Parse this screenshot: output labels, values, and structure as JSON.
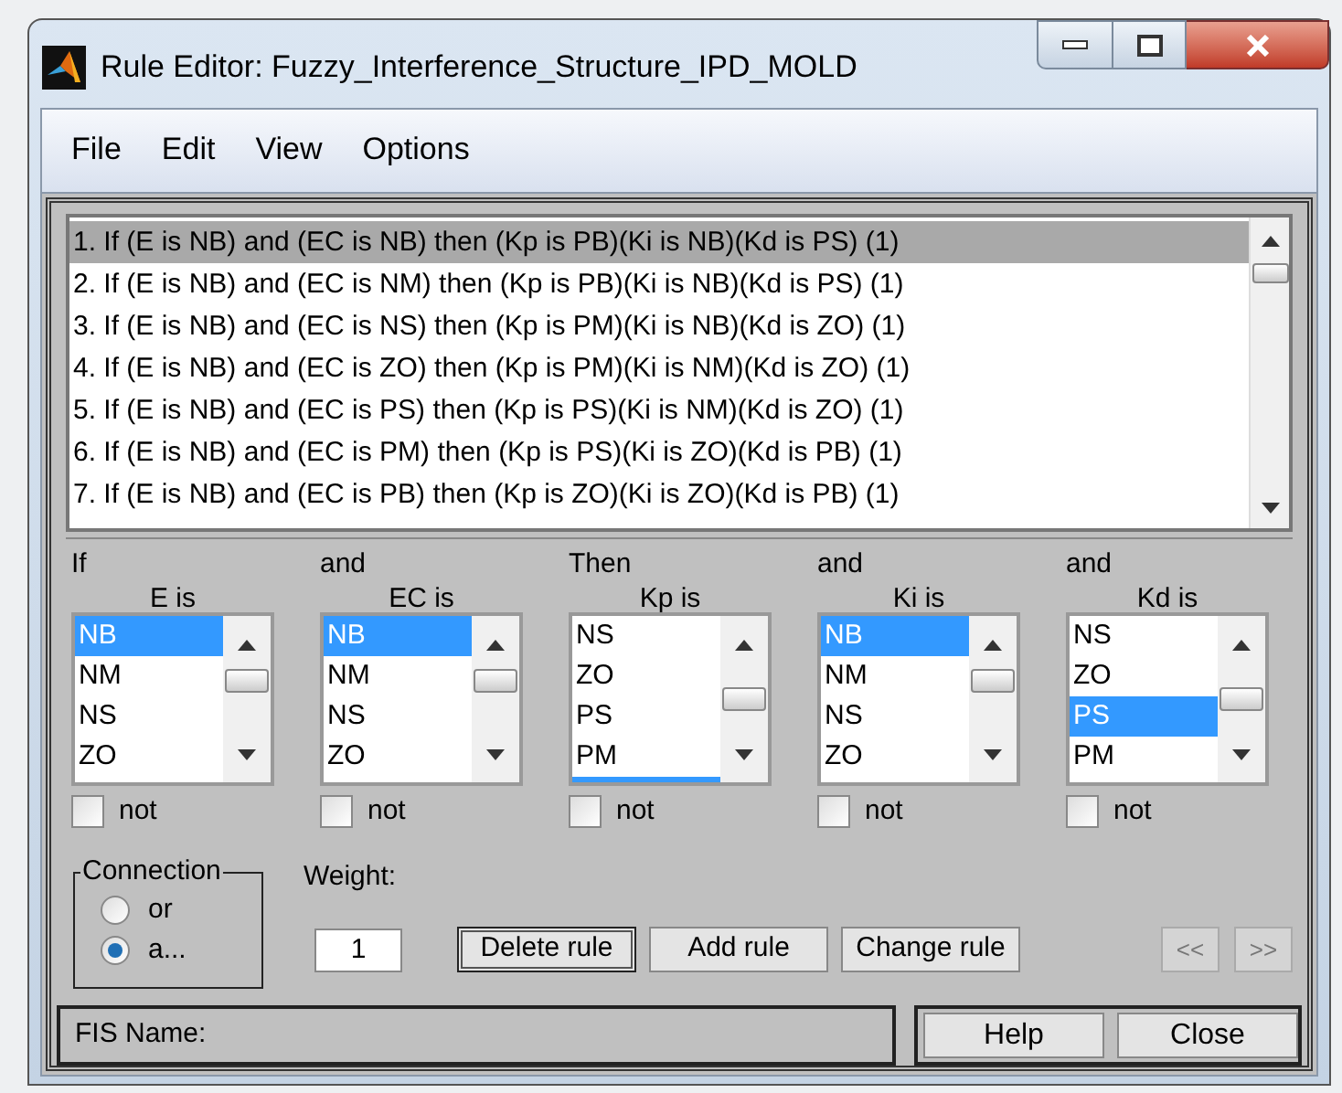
{
  "window": {
    "title": "Rule Editor: Fuzzy_Interference_Structure_IPD_MOLD"
  },
  "menu": [
    "File",
    "Edit",
    "View",
    "Options"
  ],
  "rules": [
    {
      "text": "1. If (E is NB) and (EC is NB) then (Kp is PB)(Ki is NB)(Kd is PS) (1)",
      "selected": true
    },
    {
      "text": "2. If (E is NB) and (EC is NM) then (Kp is PB)(Ki is NB)(Kd is PS) (1)",
      "selected": false
    },
    {
      "text": "3. If (E is NB) and (EC is NS) then (Kp is PM)(Ki is NB)(Kd is ZO) (1)",
      "selected": false
    },
    {
      "text": "4. If (E is NB) and (EC is ZO) then (Kp is PM)(Ki is NM)(Kd is ZO) (1)",
      "selected": false
    },
    {
      "text": "5. If (E is NB) and (EC is PS) then (Kp is PS)(Ki is NM)(Kd is ZO) (1)",
      "selected": false
    },
    {
      "text": "6. If (E is NB) and (EC is PM) then (Kp is PS)(Ki is ZO)(Kd is PB) (1)",
      "selected": false
    },
    {
      "text": "7. If (E is NB) and (EC is PB) then (Kp is ZO)(Ki is ZO)(Kd is PB) (1)",
      "selected": false
    }
  ],
  "variables": [
    {
      "prefix": "If",
      "label": "E is",
      "selection_below": false,
      "not_checked": false,
      "not_label": "not",
      "options": [
        {
          "label": "NB",
          "selected": true
        },
        {
          "label": "NM",
          "selected": false
        },
        {
          "label": "NS",
          "selected": false
        },
        {
          "label": "ZO",
          "selected": false
        }
      ]
    },
    {
      "prefix": "and",
      "label": "EC is",
      "selection_below": false,
      "not_checked": false,
      "not_label": "not",
      "options": [
        {
          "label": "NB",
          "selected": true
        },
        {
          "label": "NM",
          "selected": false
        },
        {
          "label": "NS",
          "selected": false
        },
        {
          "label": "ZO",
          "selected": false
        }
      ]
    },
    {
      "prefix": "Then",
      "label": "Kp is",
      "selection_below": true,
      "not_checked": false,
      "not_label": "not",
      "options": [
        {
          "label": "NS",
          "selected": false
        },
        {
          "label": "ZO",
          "selected": false
        },
        {
          "label": "PS",
          "selected": false
        },
        {
          "label": "PM",
          "selected": false
        }
      ]
    },
    {
      "prefix": "and",
      "label": "Ki is",
      "selection_below": false,
      "not_checked": false,
      "not_label": "not",
      "options": [
        {
          "label": "NB",
          "selected": true
        },
        {
          "label": "NM",
          "selected": false
        },
        {
          "label": "NS",
          "selected": false
        },
        {
          "label": "ZO",
          "selected": false
        }
      ]
    },
    {
      "prefix": "and",
      "label": "Kd is",
      "selection_below": false,
      "not_checked": false,
      "not_label": "not",
      "options": [
        {
          "label": "NS",
          "selected": false
        },
        {
          "label": "ZO",
          "selected": false
        },
        {
          "label": "PS",
          "selected": true
        },
        {
          "label": "PM",
          "selected": false
        }
      ]
    }
  ],
  "connection": {
    "title": "Connection",
    "options": [
      {
        "label": "or",
        "selected": false
      },
      {
        "label": "a...",
        "selected": true
      }
    ]
  },
  "weight": {
    "label": "Weight:",
    "value": "1"
  },
  "buttons": [
    {
      "label": "Delete rule",
      "focused": true
    },
    {
      "label": "Add rule",
      "focused": false
    },
    {
      "label": "Change rule",
      "focused": false
    }
  ],
  "nav_buttons": [
    {
      "label": "<<",
      "disabled": true
    },
    {
      "label": ">>",
      "disabled": true
    }
  ],
  "status": {
    "text": "FIS Name:"
  },
  "footer_buttons": [
    "Help",
    "Close"
  ]
}
